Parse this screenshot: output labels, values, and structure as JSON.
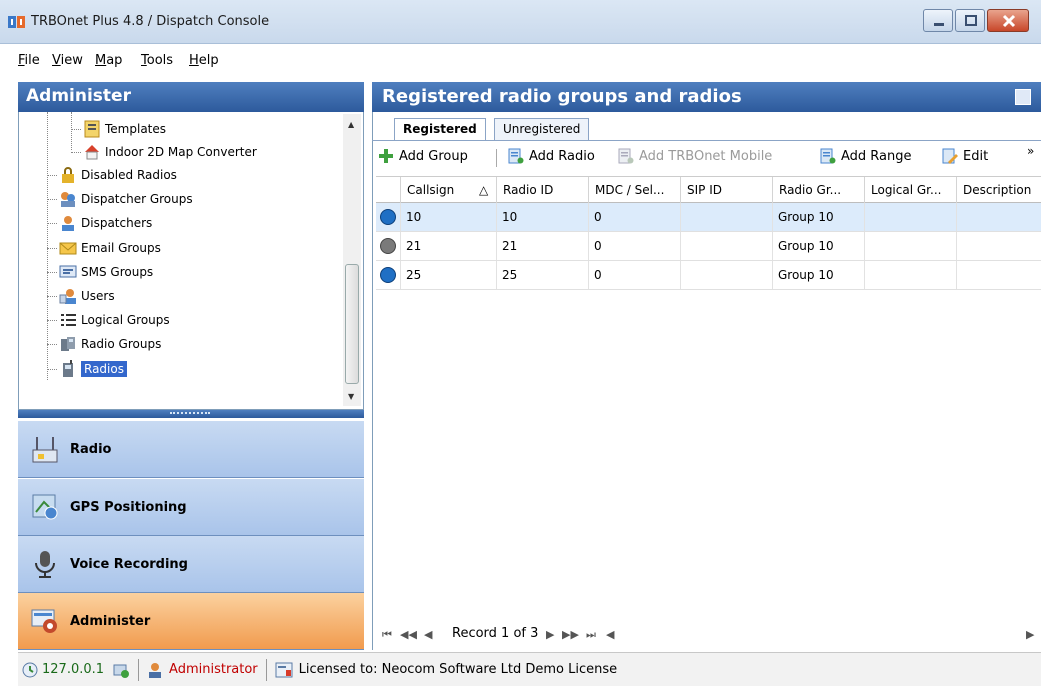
{
  "window": {
    "title": "TRBOnet Plus 4.8 / Dispatch Console",
    "controls": [
      "minimize-icon",
      "maximize-icon",
      "close-icon"
    ]
  },
  "menu": [
    "File",
    "View",
    "Map",
    "Tools",
    "Help"
  ],
  "left_pane": {
    "header": "Administer",
    "tree": [
      {
        "label": "Templates",
        "icon": "template-icon"
      },
      {
        "label": "Indoor 2D Map Converter",
        "icon": "house-icon"
      },
      {
        "label": "Disabled Radios",
        "icon": "lock-icon"
      },
      {
        "label": "Dispatcher Groups",
        "icon": "dispatcher-groups-icon"
      },
      {
        "label": "Dispatchers",
        "icon": "dispatchers-icon"
      },
      {
        "label": "Email Groups",
        "icon": "email-icon"
      },
      {
        "label": "SMS Groups",
        "icon": "sms-icon"
      },
      {
        "label": "Users",
        "icon": "users-icon"
      },
      {
        "label": "Logical Groups",
        "icon": "list-icon"
      },
      {
        "label": "Radio Groups",
        "icon": "radio-groups-icon"
      },
      {
        "label": "Radios",
        "icon": "radio-icon",
        "selected": true
      }
    ],
    "nav_buttons": [
      {
        "label": "Radio",
        "icon": "radio-tower-icon",
        "active": false
      },
      {
        "label": "GPS Positioning",
        "icon": "gps-icon",
        "active": false
      },
      {
        "label": "Voice Recording",
        "icon": "microphone-icon",
        "active": false
      },
      {
        "label": "Administer",
        "icon": "administer-icon",
        "active": true
      }
    ]
  },
  "right_pane": {
    "header": "Registered radio groups and radios",
    "tabs": [
      "Registered",
      "Unregistered"
    ],
    "toolbar": {
      "add_group": "Add Group",
      "add_radio": "Add Radio",
      "add_mobile": "Add TRBOnet Mobile",
      "add_range": "Add Range",
      "edit": "Edit",
      "overflow": "»"
    },
    "columns": [
      "Callsign",
      "Radio ID",
      "MDC / Sel...",
      "SIP ID",
      "Radio Gr...",
      "Logical Gr...",
      "Description"
    ],
    "sort_indicator": "△",
    "rows": [
      {
        "callsign": "10",
        "radio_id": "10",
        "mdc": "0",
        "sip": "",
        "radio_group": "Group 10",
        "logical": "",
        "desc": "",
        "status_color": "#1f6fc4"
      },
      {
        "callsign": "21",
        "radio_id": "21",
        "mdc": "0",
        "sip": "",
        "radio_group": "Group 10",
        "logical": "",
        "desc": "",
        "status_color": "#7a7a7a"
      },
      {
        "callsign": "25",
        "radio_id": "25",
        "mdc": "0",
        "sip": "",
        "radio_group": "Group 10",
        "logical": "",
        "desc": "",
        "status_color": "#1f6fc4"
      }
    ],
    "navigator": {
      "record_text": "Record 1 of 3"
    }
  },
  "statusbar": {
    "ip": "127.0.0.1",
    "user": "Administrator",
    "license": "Licensed to: Neocom Software Ltd Demo License"
  },
  "colors": {
    "header_blue": "#2d5a9c",
    "active_orange": "#f19b4e",
    "selection_blue": "#3367cc",
    "user_red": "#c00000"
  }
}
